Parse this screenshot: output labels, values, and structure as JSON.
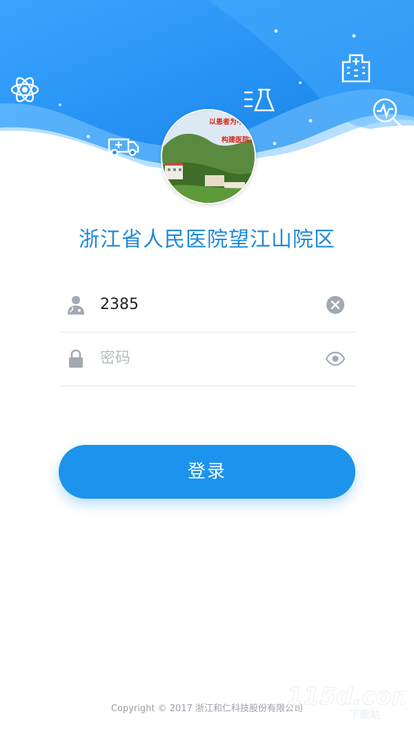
{
  "header": {
    "colors": {
      "bg_top": "#1f8ff0",
      "bg_light": "#6fc0ff",
      "wave": "#ffffff"
    },
    "icons": [
      "atom-icon",
      "ambulance-icon",
      "flask-icon",
      "hospital-building-icon",
      "heart-monitor-search-icon"
    ]
  },
  "avatar": {
    "banner_line1": "以患者为中心",
    "banner_line2": "构建医院发展"
  },
  "hospital_name": "浙江省人民医院望江山院区",
  "login": {
    "username": {
      "value": "2385",
      "icon": "doctor-icon",
      "clear_icon": "clear-icon"
    },
    "password": {
      "placeholder": "密码",
      "icon": "lock-icon",
      "toggle_icon": "eye-icon"
    },
    "button_label": "登录",
    "accent": "#1c93ec"
  },
  "footer": {
    "copyright": "Copyright © 2017 浙江和仁科技股份有限公司"
  },
  "watermark": {
    "brand": "115d.com",
    "sub": "下载站"
  }
}
